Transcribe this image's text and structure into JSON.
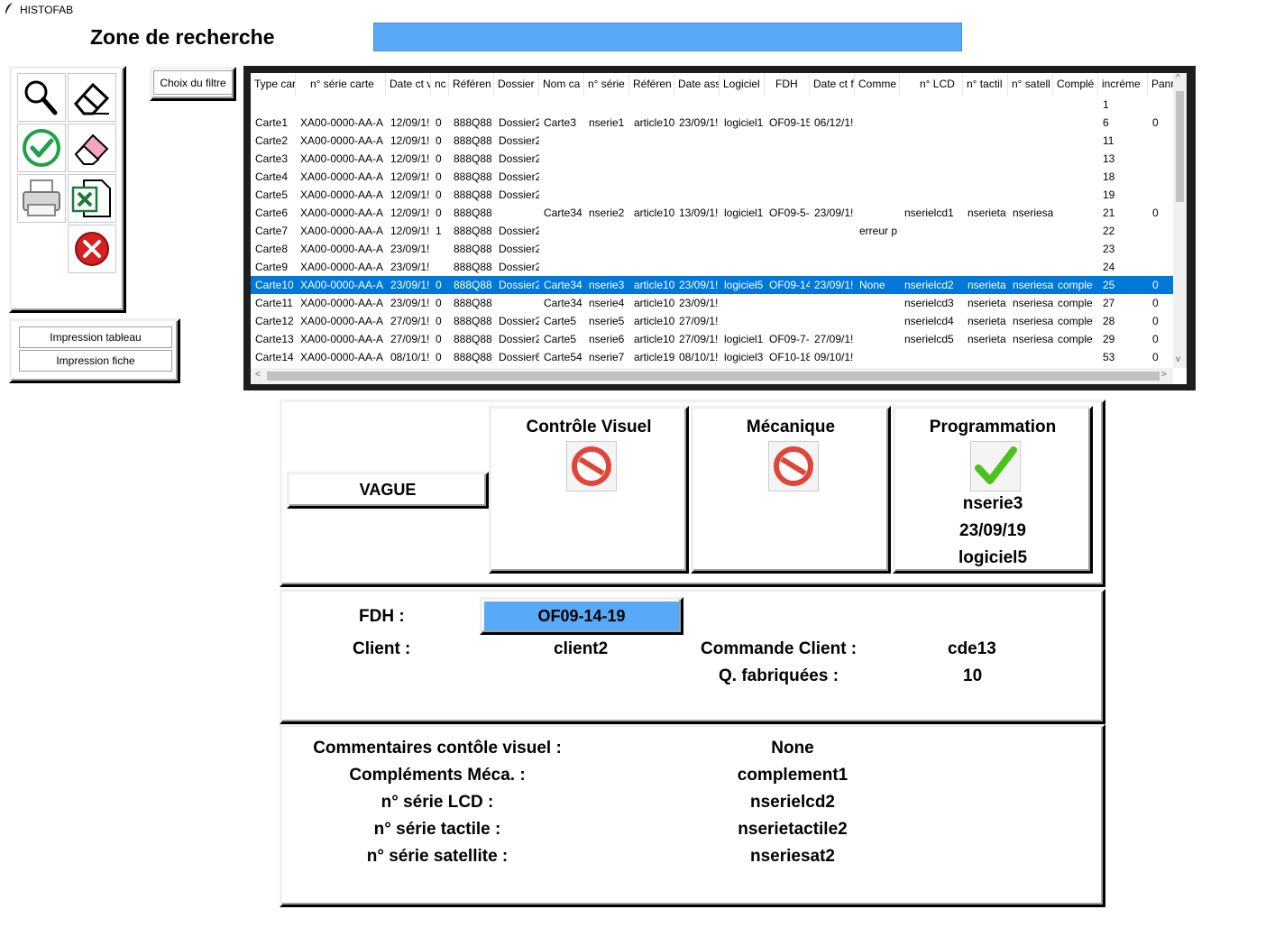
{
  "window": {
    "title": "HISTOFAB"
  },
  "search": {
    "label": "Zone de recherche",
    "value": ""
  },
  "toolbar": {
    "filter_label": "Choix du filtre"
  },
  "print": {
    "table_label": "Impression tableau",
    "sheet_label": "Impression fiche"
  },
  "table": {
    "columns": [
      "Type car",
      "n° série carte",
      "Date ct v",
      "nc",
      "Référen",
      "Dossier",
      "Nom ca",
      "n° série",
      "Référen",
      "Date ass",
      "Logiciel",
      "FDH",
      "Date ct f",
      "Comme",
      "n° LCD",
      "n° tactil",
      "n° satell",
      "Complé",
      "incréme",
      "Panr"
    ],
    "rows": [
      [
        "",
        "",
        "",
        "",
        "",
        "",
        "",
        "",
        "",
        "",
        "",
        "",
        "",
        "",
        "",
        "",
        "",
        "",
        "1",
        ""
      ],
      [
        "Carte1",
        "XA00-0000-AA-A",
        "12/09/1!",
        "0",
        "888Q88",
        "Dossier2",
        "Carte3",
        "nserie1",
        "article10",
        "23/09/1!",
        "logiciel1",
        "OF09-15",
        "06/12/1!",
        "",
        "",
        "",
        "",
        "",
        "6",
        "0"
      ],
      [
        "Carte2",
        "XA00-0000-AA-A",
        "12/09/1!",
        "0",
        "888Q88",
        "Dossier2",
        "",
        "",
        "",
        "",
        "",
        "",
        "",
        "",
        "",
        "",
        "",
        "",
        "11",
        ""
      ],
      [
        "Carte3",
        "XA00-0000-AA-A",
        "12/09/1!",
        "0",
        "888Q88",
        "Dossier2",
        "",
        "",
        "",
        "",
        "",
        "",
        "",
        "",
        "",
        "",
        "",
        "",
        "13",
        ""
      ],
      [
        "Carte4",
        "XA00-0000-AA-A",
        "12/09/1!",
        "0",
        "888Q88",
        "Dossier2",
        "",
        "",
        "",
        "",
        "",
        "",
        "",
        "",
        "",
        "",
        "",
        "",
        "18",
        ""
      ],
      [
        "Carte5",
        "XA00-0000-AA-A",
        "12/09/1!",
        "0",
        "888Q88",
        "Dossier2",
        "",
        "",
        "",
        "",
        "",
        "",
        "",
        "",
        "",
        "",
        "",
        "",
        "19",
        ""
      ],
      [
        "Carte6",
        "XA00-0000-AA-A",
        "12/09/1!",
        "0",
        "888Q88",
        "",
        "Carte34",
        "nserie2",
        "article10",
        "13/09/1!",
        "logiciel1",
        "OF09-5-",
        "23/09/1!",
        "",
        "nserielcd1",
        "nserieta",
        "nseriesa",
        "",
        "21",
        "0"
      ],
      [
        "Carte7",
        "XA00-0000-AA-A",
        "12/09/1!",
        "1",
        "888Q88",
        "Dossier2",
        "",
        "",
        "",
        "",
        "",
        "",
        "",
        "erreur p",
        "",
        "",
        "",
        "",
        "22",
        ""
      ],
      [
        "Carte8",
        "XA00-0000-AA-A",
        "23/09/1!",
        "",
        "888Q88",
        "Dossier2",
        "",
        "",
        "",
        "",
        "",
        "",
        "",
        "",
        "",
        "",
        "",
        "",
        "23",
        ""
      ],
      [
        "Carte9",
        "XA00-0000-AA-A",
        "23/09/1!",
        "",
        "888Q88",
        "Dossier2",
        "",
        "",
        "",
        "",
        "",
        "",
        "",
        "",
        "",
        "",
        "",
        "",
        "24",
        ""
      ],
      [
        "Carte10",
        "XA00-0000-AA-A",
        "23/09/1!",
        "0",
        "888Q88",
        "Dossier2",
        "Carte34",
        "nserie3",
        "article10",
        "23/09/1!",
        "logiciel5",
        "OF09-14",
        "23/09/1!",
        "None",
        "nserielcd2",
        "nserieta",
        "nseriesa",
        "comple",
        "25",
        "0"
      ],
      [
        "Carte11",
        "XA00-0000-AA-A",
        "23/09/1!",
        "0",
        "888Q88",
        "",
        "Carte34",
        "nserie4",
        "article10",
        "23/09/1!",
        "",
        "",
        "",
        "",
        "nserielcd3",
        "nserieta",
        "nseriesa",
        "comple",
        "27",
        "0"
      ],
      [
        "Carte12",
        "XA00-0000-AA-A",
        "27/09/1!",
        "0",
        "888Q88",
        "Dossier2",
        "Carte5",
        "nserie5",
        "article10",
        "27/09/1!",
        "",
        "",
        "",
        "",
        "nserielcd4",
        "nserieta",
        "nseriesa",
        "comple",
        "28",
        "0"
      ],
      [
        "Carte13",
        "XA00-0000-AA-A",
        "27/09/1!",
        "0",
        "888Q88",
        "Dossier2",
        "Carte5",
        "nserie6",
        "article10",
        "27/09/1!",
        "logiciel1",
        "OF09-7-",
        "27/09/1!",
        "",
        "nserielcd5",
        "nserieta",
        "nseriesa",
        "comple",
        "29",
        "0"
      ],
      [
        "Carte14",
        "XA00-0000-AA-A",
        "08/10/1!",
        "0",
        "888Q88",
        "Dossier6",
        "Carte54",
        "nserie7",
        "article19",
        "08/10/1!",
        "logiciel3",
        "OF10-18",
        "09/10/1!",
        "",
        "",
        "",
        "",
        "",
        "53",
        "0"
      ]
    ],
    "selected_row": 10
  },
  "status": {
    "vague_label": "VAGUE",
    "stages": [
      {
        "title": "Contrôle Visuel",
        "state": "blocked",
        "lines": []
      },
      {
        "title": "Mécanique",
        "state": "blocked",
        "lines": []
      },
      {
        "title": "Programmation",
        "state": "done",
        "lines": [
          "nserie3",
          "23/09/19",
          "logiciel5"
        ]
      }
    ]
  },
  "fdh": {
    "label": "FDH :",
    "value": "OF09-14-19",
    "client_label": "Client :",
    "client_value": "client2",
    "order_label": "Commande Client :",
    "order_value": "cde13",
    "qty_label": "Q. fabriquées :",
    "qty_value": "10"
  },
  "comments": {
    "fields": [
      {
        "label": "Commentaires contôle visuel :",
        "value": "None"
      },
      {
        "label": "Compléments Méca. :",
        "value": "complement1"
      },
      {
        "label": "n° série LCD :",
        "value": "nserielcd2"
      },
      {
        "label": "n° série tactile :",
        "value": "nserietactile2"
      },
      {
        "label": "n° série satellite :",
        "value": "nseriesat2"
      }
    ]
  },
  "colors": {
    "accent": "#58a9f8",
    "selection": "#0078d7",
    "ok": "#4cc21c",
    "blocked": "#e0453a"
  }
}
